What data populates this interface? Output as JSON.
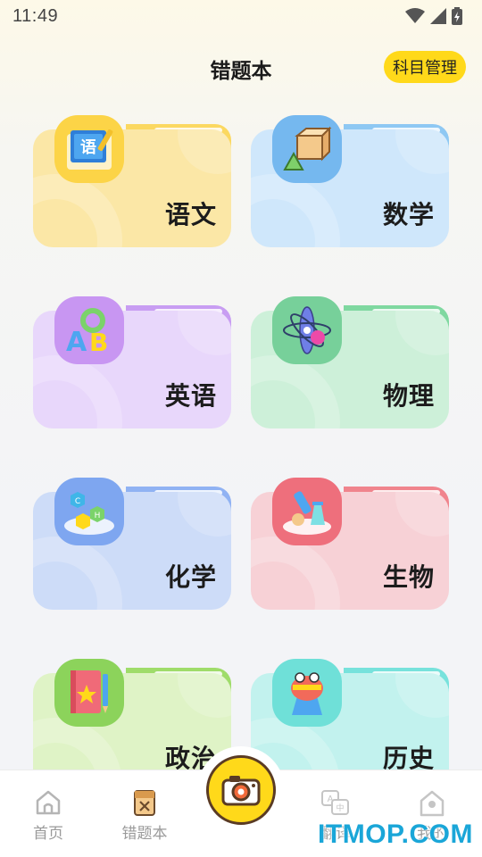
{
  "status_bar": {
    "time": "11:49"
  },
  "header": {
    "title": "错题本",
    "manage_button": "科目管理"
  },
  "subjects": [
    {
      "label": "语文",
      "icon": "chinese-book-icon",
      "color": "#fbe7a6"
    },
    {
      "label": "数学",
      "icon": "geometry-cube-icon",
      "color": "#cfe7fb"
    },
    {
      "label": "英语",
      "icon": "abc-letters-icon",
      "color": "#e8d7fb"
    },
    {
      "label": "物理",
      "icon": "atom-icon",
      "color": "#cdf0d9"
    },
    {
      "label": "化学",
      "icon": "molecule-icon",
      "color": "#cddcf8"
    },
    {
      "label": "生物",
      "icon": "microscope-icon",
      "color": "#f7d1d6"
    },
    {
      "label": "政治",
      "icon": "star-notebook-icon",
      "color": "#dff3c6"
    },
    {
      "label": "历史",
      "icon": "history-figure-icon",
      "color": "#c2f2ee"
    }
  ],
  "bottom_nav": {
    "home": "首页",
    "mistakes": "错题本",
    "translate": "翻译",
    "mine": "我的"
  },
  "watermark": "ITMOP.COM"
}
